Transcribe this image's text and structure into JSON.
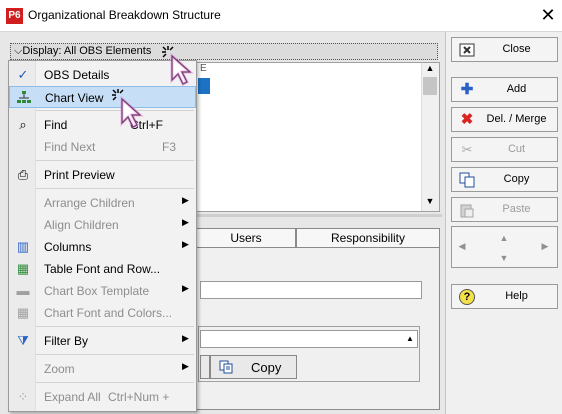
{
  "window": {
    "logo_text": "P6",
    "title": "Organizational Breakdown Structure",
    "close_glyph": "✕"
  },
  "display_bar": {
    "label": "Display: All OBS Elements"
  },
  "tree": {
    "column_header_fragment": "E"
  },
  "tabs": [
    {
      "label": "Users"
    },
    {
      "label": "Responsibility"
    }
  ],
  "lower_pane": {
    "copy_label": "Copy"
  },
  "side_buttons": {
    "close": "Close",
    "add": "Add",
    "delete_merge": "Del. / Merge",
    "cut": "Cut",
    "copy": "Copy",
    "paste": "Paste",
    "help": "Help"
  },
  "context_menu": {
    "obs_details": "OBS Details",
    "chart_view": "Chart View",
    "find": "Find",
    "find_shortcut": "Ctrl+F",
    "find_next": "Find Next",
    "find_next_shortcut": "F3",
    "print_preview": "Print Preview",
    "arrange_children": "Arrange Children",
    "align_children": "Align Children",
    "columns": "Columns",
    "table_font_row": "Table Font and Row...",
    "chart_box_template": "Chart Box Template",
    "chart_font_colors": "Chart Font and Colors...",
    "filter_by": "Filter By",
    "zoom": "Zoom",
    "expand_all": "Expand All",
    "expand_all_shortcut": "Ctrl+Num +"
  },
  "colors": {
    "selection_blue": "#1d72c4",
    "menu_highlight": "#c6dff6",
    "delete_red": "#d9241f",
    "logo_red": "#d11f1f"
  }
}
